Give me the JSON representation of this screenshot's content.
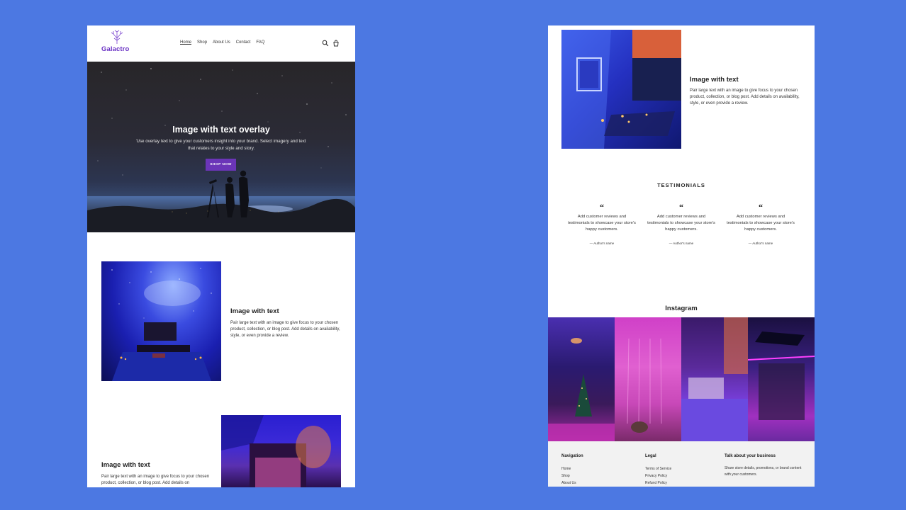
{
  "left_page": {
    "header": {
      "logo_text": "Galactro",
      "nav": [
        {
          "label": "Home",
          "active": true
        },
        {
          "label": "Shop",
          "active": false
        },
        {
          "label": "About Us",
          "active": false
        },
        {
          "label": "Contact",
          "active": false
        },
        {
          "label": "FAQ",
          "active": false
        }
      ],
      "icons": [
        "search-icon",
        "cart-icon"
      ]
    },
    "hero": {
      "title": "Image with text overlay",
      "subtitle": "Use overlay text to give your customers insight into your brand. Select imagery and text that relates to your style and story.",
      "button_label": "SHOP NOW",
      "button_color": "#6b35b8"
    },
    "blocks": [
      {
        "title": "Image with text",
        "text": "Pair large text with an image to give focus to your chosen product, collection, or blog post. Add details on availability, style, or even provide a review."
      },
      {
        "title": "Image with text",
        "text": "Pair large text with an image to give focus to your chosen product, collection, or blog post. Add details on"
      }
    ]
  },
  "right_page": {
    "block": {
      "title": "Image with text",
      "text": "Pair large text with an image to give focus to your chosen product, collection, or blog post. Add details on availability, style, or even provide a review."
    },
    "testimonials": {
      "heading": "TESTIMONIALS",
      "items": [
        {
          "quote": "Add customer reviews and testimonials to showcase your store's happy customers.",
          "author": "— Author's name"
        },
        {
          "quote": "Add customer reviews and testimonials to showcase your store's happy customers.",
          "author": "— Author's name"
        },
        {
          "quote": "Add customer reviews and testimonials to showcase your store's happy customers.",
          "author": "— Author's name"
        }
      ]
    },
    "instagram": {
      "heading": "Instagram"
    },
    "footer": {
      "navigation": {
        "heading": "Navigation",
        "links": [
          "Home",
          "Shop",
          "About Us"
        ]
      },
      "legal": {
        "heading": "Legal",
        "links": [
          "Terms of Service",
          "Privacy Policy",
          "Refund Policy"
        ]
      },
      "business": {
        "heading": "Talk about your business",
        "text": "Share store details, promotions, or brand content with your customers."
      }
    }
  },
  "colors": {
    "background": "#4c78e2",
    "accent": "#6b35b8",
    "logo": "#6a32c4",
    "footer_bg": "#f2f2f2"
  }
}
